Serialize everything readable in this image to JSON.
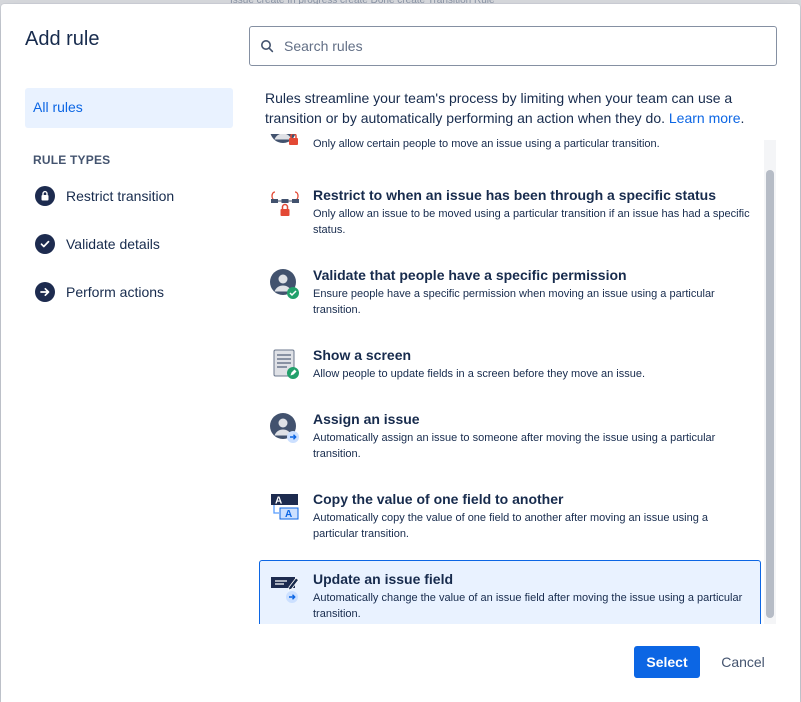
{
  "background": {
    "strip_text": "Issue create   In progress create   Done create   Transition   Rule"
  },
  "dialog": {
    "title": "Add rule"
  },
  "sidebar": {
    "all_rules_label": "All rules",
    "rule_types_heading": "RULE TYPES",
    "categories": [
      {
        "label": "Restrict transition",
        "icon": "lock-icon"
      },
      {
        "label": "Validate details",
        "icon": "check-icon"
      },
      {
        "label": "Perform actions",
        "icon": "arrow-right-icon"
      }
    ]
  },
  "search": {
    "placeholder": "Search rules",
    "value": ""
  },
  "intro": {
    "text": "Rules streamline your team's process by limiting when your team can use a transition or by automatically performing an action when they do.",
    "link_label": "Learn more",
    "after_link": "."
  },
  "rules": [
    {
      "title": "",
      "description": "Only allow certain people to move an issue using a particular transition.",
      "icon": "person-lock-icon"
    },
    {
      "title": "Restrict to when an issue has been through a specific status",
      "description": "Only allow an issue to be moved using a particular transition if an issue has had a specific status.",
      "icon": "workflow-lock-icon"
    },
    {
      "title": "Validate that people have a specific permission",
      "description": "Ensure people have a specific permission when moving an issue using a particular transition.",
      "icon": "person-check-icon"
    },
    {
      "title": "Show a screen",
      "description": "Allow people to update fields in a screen before they move an issue.",
      "icon": "screen-edit-icon"
    },
    {
      "title": "Assign an issue",
      "description": "Automatically assign an issue to someone after moving the issue using a particular transition.",
      "icon": "person-arrow-icon"
    },
    {
      "title": "Copy the value of one field to another",
      "description": "Automatically copy the value of one field to another after moving an issue using a particular transition.",
      "icon": "copy-field-icon"
    },
    {
      "title": "Update an issue field",
      "description": "Automatically change the value of an issue field after moving the issue using a particular transition.",
      "icon": "update-field-icon",
      "selected": true
    }
  ],
  "footer": {
    "select_label": "Select",
    "cancel_label": "Cancel"
  },
  "colors": {
    "primary": "#0c66e4",
    "selected_bg": "#e9f2ff",
    "lock_red": "#e34935",
    "check_green": "#22a06b",
    "arrow_blue": "#579dff"
  }
}
